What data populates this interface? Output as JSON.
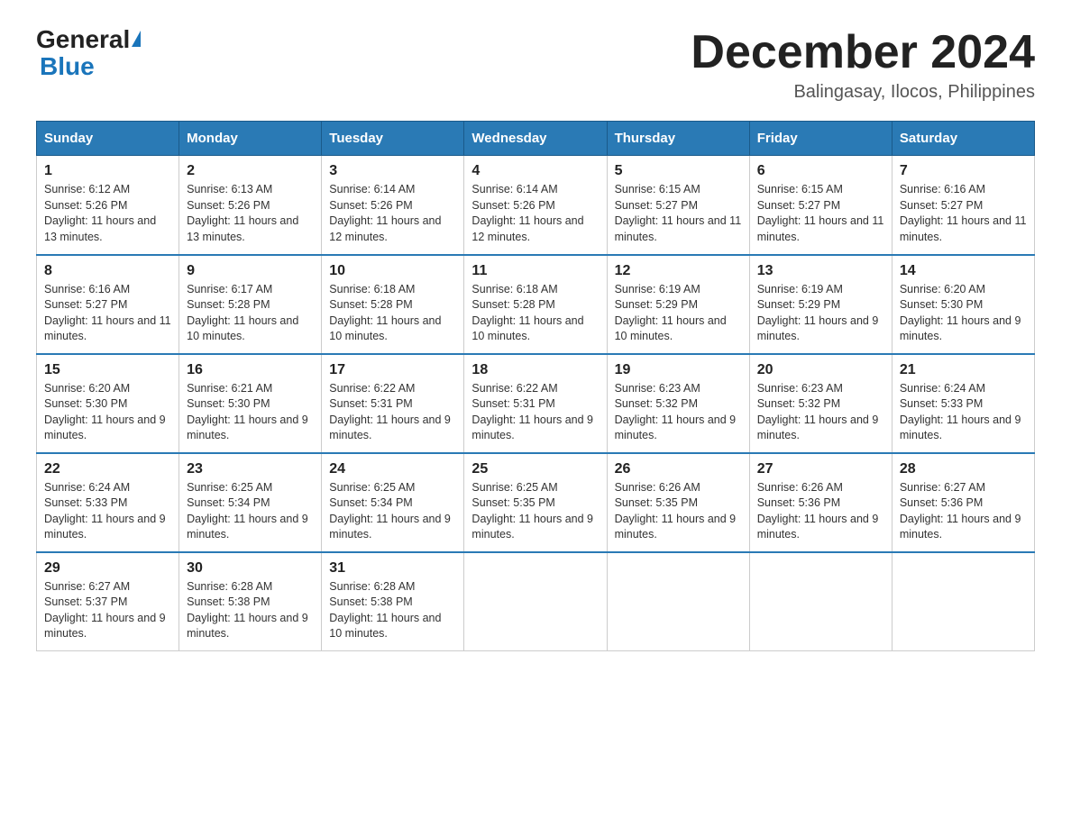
{
  "logo": {
    "general": "General",
    "blue": "Blue"
  },
  "title": "December 2024",
  "location": "Balingasay, Ilocos, Philippines",
  "days_of_week": [
    "Sunday",
    "Monday",
    "Tuesday",
    "Wednesday",
    "Thursday",
    "Friday",
    "Saturday"
  ],
  "weeks": [
    [
      {
        "day": "1",
        "sunrise": "6:12 AM",
        "sunset": "5:26 PM",
        "daylight": "11 hours and 13 minutes."
      },
      {
        "day": "2",
        "sunrise": "6:13 AM",
        "sunset": "5:26 PM",
        "daylight": "11 hours and 13 minutes."
      },
      {
        "day": "3",
        "sunrise": "6:14 AM",
        "sunset": "5:26 PM",
        "daylight": "11 hours and 12 minutes."
      },
      {
        "day": "4",
        "sunrise": "6:14 AM",
        "sunset": "5:26 PM",
        "daylight": "11 hours and 12 minutes."
      },
      {
        "day": "5",
        "sunrise": "6:15 AM",
        "sunset": "5:27 PM",
        "daylight": "11 hours and 11 minutes."
      },
      {
        "day": "6",
        "sunrise": "6:15 AM",
        "sunset": "5:27 PM",
        "daylight": "11 hours and 11 minutes."
      },
      {
        "day": "7",
        "sunrise": "6:16 AM",
        "sunset": "5:27 PM",
        "daylight": "11 hours and 11 minutes."
      }
    ],
    [
      {
        "day": "8",
        "sunrise": "6:16 AM",
        "sunset": "5:27 PM",
        "daylight": "11 hours and 11 minutes."
      },
      {
        "day": "9",
        "sunrise": "6:17 AM",
        "sunset": "5:28 PM",
        "daylight": "11 hours and 10 minutes."
      },
      {
        "day": "10",
        "sunrise": "6:18 AM",
        "sunset": "5:28 PM",
        "daylight": "11 hours and 10 minutes."
      },
      {
        "day": "11",
        "sunrise": "6:18 AM",
        "sunset": "5:28 PM",
        "daylight": "11 hours and 10 minutes."
      },
      {
        "day": "12",
        "sunrise": "6:19 AM",
        "sunset": "5:29 PM",
        "daylight": "11 hours and 10 minutes."
      },
      {
        "day": "13",
        "sunrise": "6:19 AM",
        "sunset": "5:29 PM",
        "daylight": "11 hours and 9 minutes."
      },
      {
        "day": "14",
        "sunrise": "6:20 AM",
        "sunset": "5:30 PM",
        "daylight": "11 hours and 9 minutes."
      }
    ],
    [
      {
        "day": "15",
        "sunrise": "6:20 AM",
        "sunset": "5:30 PM",
        "daylight": "11 hours and 9 minutes."
      },
      {
        "day": "16",
        "sunrise": "6:21 AM",
        "sunset": "5:30 PM",
        "daylight": "11 hours and 9 minutes."
      },
      {
        "day": "17",
        "sunrise": "6:22 AM",
        "sunset": "5:31 PM",
        "daylight": "11 hours and 9 minutes."
      },
      {
        "day": "18",
        "sunrise": "6:22 AM",
        "sunset": "5:31 PM",
        "daylight": "11 hours and 9 minutes."
      },
      {
        "day": "19",
        "sunrise": "6:23 AM",
        "sunset": "5:32 PM",
        "daylight": "11 hours and 9 minutes."
      },
      {
        "day": "20",
        "sunrise": "6:23 AM",
        "sunset": "5:32 PM",
        "daylight": "11 hours and 9 minutes."
      },
      {
        "day": "21",
        "sunrise": "6:24 AM",
        "sunset": "5:33 PM",
        "daylight": "11 hours and 9 minutes."
      }
    ],
    [
      {
        "day": "22",
        "sunrise": "6:24 AM",
        "sunset": "5:33 PM",
        "daylight": "11 hours and 9 minutes."
      },
      {
        "day": "23",
        "sunrise": "6:25 AM",
        "sunset": "5:34 PM",
        "daylight": "11 hours and 9 minutes."
      },
      {
        "day": "24",
        "sunrise": "6:25 AM",
        "sunset": "5:34 PM",
        "daylight": "11 hours and 9 minutes."
      },
      {
        "day": "25",
        "sunrise": "6:25 AM",
        "sunset": "5:35 PM",
        "daylight": "11 hours and 9 minutes."
      },
      {
        "day": "26",
        "sunrise": "6:26 AM",
        "sunset": "5:35 PM",
        "daylight": "11 hours and 9 minutes."
      },
      {
        "day": "27",
        "sunrise": "6:26 AM",
        "sunset": "5:36 PM",
        "daylight": "11 hours and 9 minutes."
      },
      {
        "day": "28",
        "sunrise": "6:27 AM",
        "sunset": "5:36 PM",
        "daylight": "11 hours and 9 minutes."
      }
    ],
    [
      {
        "day": "29",
        "sunrise": "6:27 AM",
        "sunset": "5:37 PM",
        "daylight": "11 hours and 9 minutes."
      },
      {
        "day": "30",
        "sunrise": "6:28 AM",
        "sunset": "5:38 PM",
        "daylight": "11 hours and 9 minutes."
      },
      {
        "day": "31",
        "sunrise": "6:28 AM",
        "sunset": "5:38 PM",
        "daylight": "11 hours and 10 minutes."
      },
      null,
      null,
      null,
      null
    ]
  ]
}
